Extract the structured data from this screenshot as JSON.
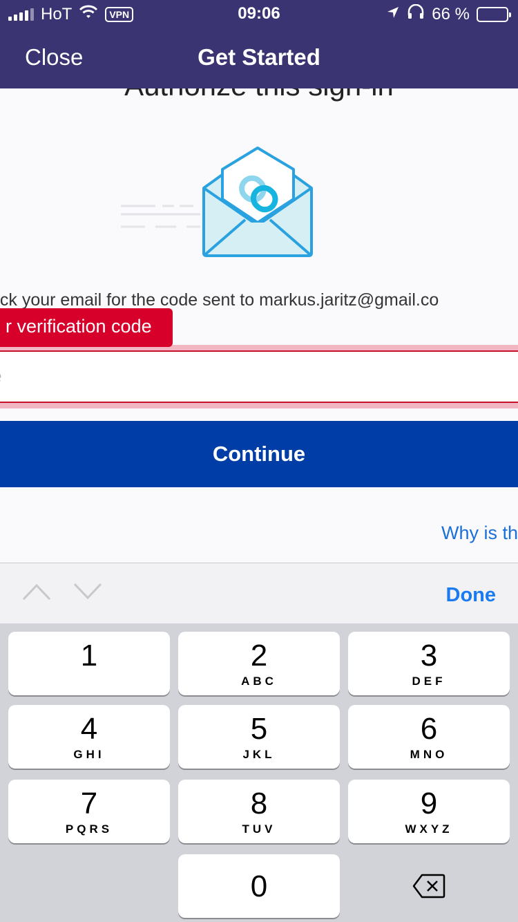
{
  "status_bar": {
    "carrier": "HoT",
    "vpn": "VPN",
    "time": "09:06",
    "battery": "66 %"
  },
  "nav": {
    "close": "Close",
    "title": "Get Started"
  },
  "content": {
    "heading": "Authorize this sign-in",
    "email_text": "eck your email for the code sent to markus.jaritz@gmail.co",
    "error_text": "r verification code",
    "input_placeholder": "e",
    "continue": "Continue",
    "why_link": "Why is th"
  },
  "accessory": {
    "done": "Done"
  },
  "keypad": {
    "keys": [
      {
        "digit": "1",
        "letters": ""
      },
      {
        "digit": "2",
        "letters": "ABC"
      },
      {
        "digit": "3",
        "letters": "DEF"
      },
      {
        "digit": "4",
        "letters": "GHI"
      },
      {
        "digit": "5",
        "letters": "JKL"
      },
      {
        "digit": "6",
        "letters": "MNO"
      },
      {
        "digit": "7",
        "letters": "PQRS"
      },
      {
        "digit": "8",
        "letters": "TUV"
      },
      {
        "digit": "9",
        "letters": "WXYZ"
      },
      {
        "digit": "0",
        "letters": ""
      }
    ]
  },
  "colors": {
    "nav_bg": "#3a3572",
    "button_blue": "#003da6",
    "error_red": "#d6002a",
    "link_blue": "#1a6fd8"
  }
}
